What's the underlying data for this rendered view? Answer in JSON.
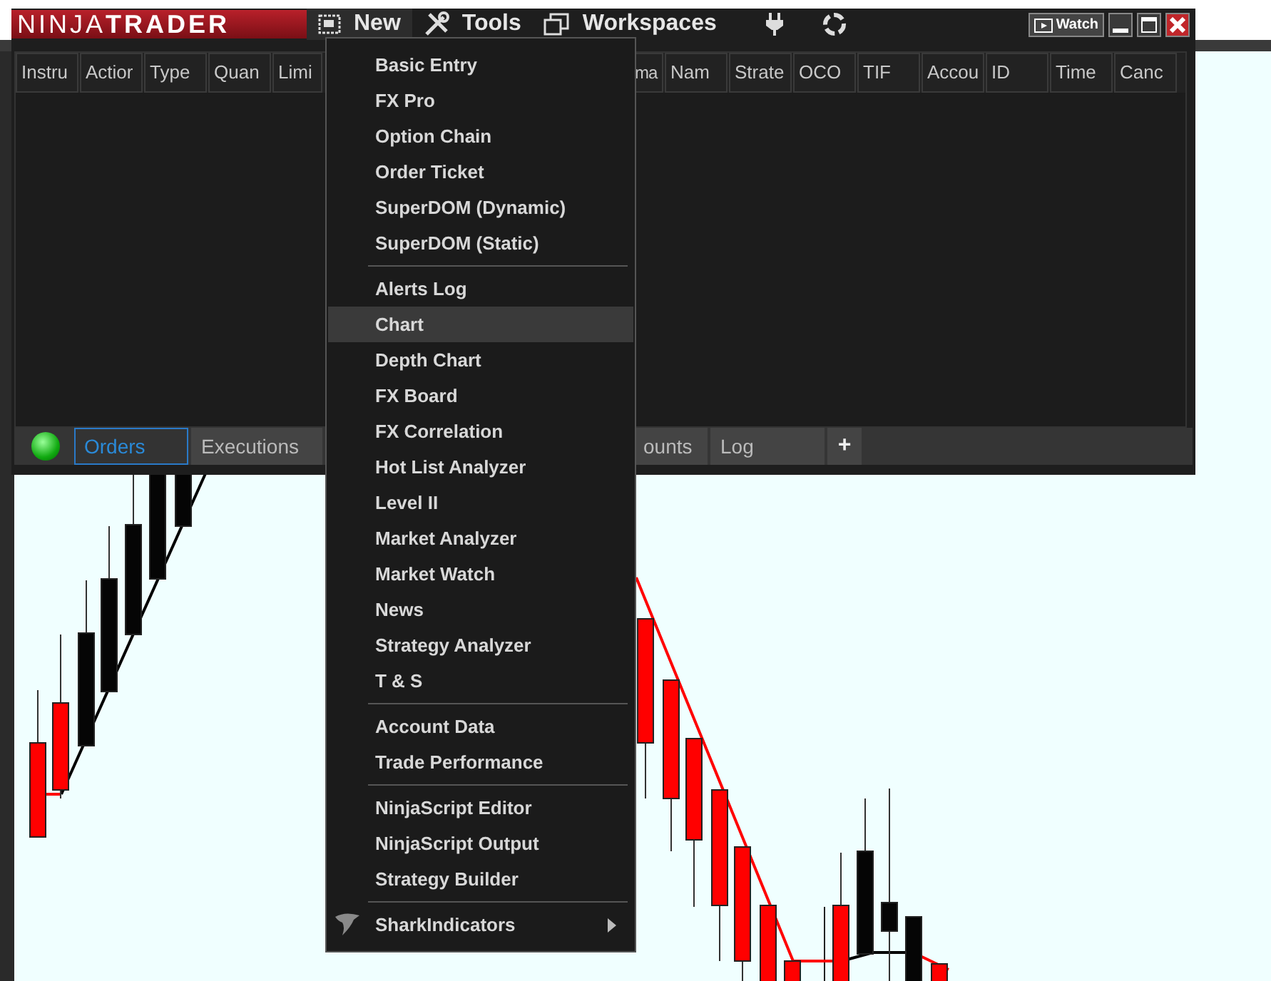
{
  "window": {
    "logo": "NINJA**TRADER**",
    "menubar": [
      {
        "label": "New",
        "open": true
      },
      {
        "label": "Tools",
        "open": false
      },
      {
        "label": "Workspaces",
        "open": false
      }
    ],
    "watch_button": "Watch"
  },
  "orders_grid": {
    "columns_left": [
      "Instru",
      "Actior",
      "Type",
      "Quan",
      "Limi"
    ],
    "columns_right": [
      "ma",
      "Nam",
      "Strate",
      "OCO",
      "TIF",
      "Accou",
      "ID",
      "Time",
      "Canc"
    ]
  },
  "tabs_left": [
    {
      "label": "Orders",
      "selected": true
    },
    {
      "label": "Executions",
      "selected": false
    }
  ],
  "tabs_right": [
    {
      "label": "ounts",
      "selected": false
    },
    {
      "label": "Log",
      "selected": false
    }
  ],
  "add_tab": "+",
  "new_menu": {
    "sections": [
      [
        {
          "label": "Basic Entry",
          "highlighted": false
        },
        {
          "label": "FX Pro",
          "highlighted": false
        },
        {
          "label": "Option Chain",
          "highlighted": false
        },
        {
          "label": "Order Ticket",
          "highlighted": false
        },
        {
          "label": "SuperDOM (Dynamic)",
          "highlighted": false
        },
        {
          "label": "SuperDOM (Static)",
          "highlighted": false
        }
      ],
      [
        {
          "label": "Alerts Log",
          "highlighted": false
        },
        {
          "label": "Chart",
          "highlighted": true
        },
        {
          "label": "Depth Chart",
          "highlighted": false
        },
        {
          "label": "FX Board",
          "highlighted": false
        },
        {
          "label": "FX Correlation",
          "highlighted": false
        },
        {
          "label": "Hot List Analyzer",
          "highlighted": false
        },
        {
          "label": "Level II",
          "highlighted": false
        },
        {
          "label": "Market Analyzer",
          "highlighted": false
        },
        {
          "label": "Market Watch",
          "highlighted": false
        },
        {
          "label": "News",
          "highlighted": false
        },
        {
          "label": "Strategy Analyzer",
          "highlighted": false
        },
        {
          "label": "T & S",
          "highlighted": false
        }
      ],
      [
        {
          "label": "Account Data",
          "highlighted": false
        },
        {
          "label": "Trade Performance",
          "highlighted": false
        }
      ],
      [
        {
          "label": "NinjaScript Editor",
          "highlighted": false
        },
        {
          "label": "NinjaScript Output",
          "highlighted": false
        },
        {
          "label": "Strategy Builder",
          "highlighted": false
        }
      ],
      [
        {
          "label": "SharkIndicators",
          "highlighted": false,
          "kind": "submenu"
        }
      ]
    ]
  }
}
